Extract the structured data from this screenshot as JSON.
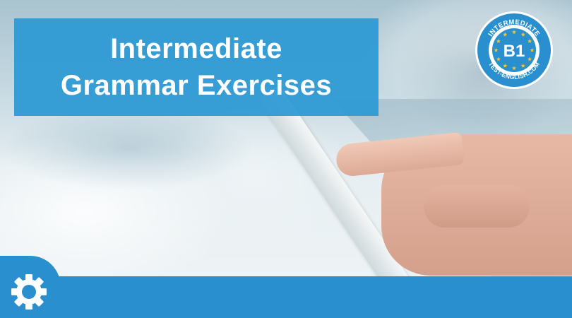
{
  "title": {
    "line1": "Intermediate",
    "line2": "Grammar Exercises"
  },
  "badge": {
    "level": "B1",
    "top_text": "INTERMEDIATE",
    "bottom_text": "TEST-ENGLISH.COM"
  },
  "icons": {
    "settings": "gear-icon"
  },
  "colors": {
    "accent": "#2a8fcf",
    "title_bg": "#2a98d4",
    "badge_ring": "#2a8fcf",
    "badge_stars": "#f2c530"
  }
}
